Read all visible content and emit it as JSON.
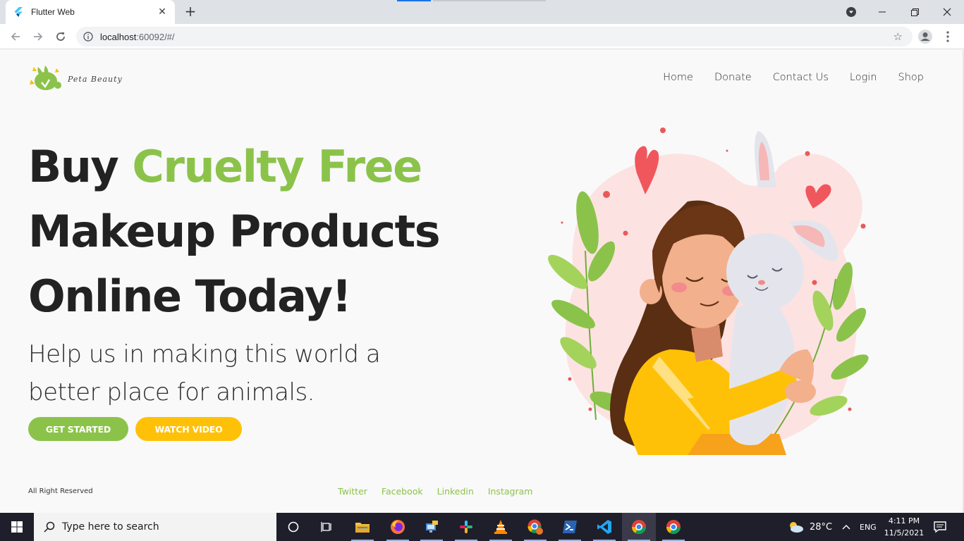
{
  "browser": {
    "tab_title": "Flutter Web",
    "url_host": "localhost",
    "url_rest": ":60092/#/",
    "close_glyph": "✕",
    "new_tab_glyph": "+"
  },
  "site": {
    "logo_text": "Peta Beauty",
    "nav": [
      "Home",
      "Donate",
      "Contact Us",
      "Login",
      "Shop"
    ],
    "headline_1a": "Buy ",
    "headline_1b": "Cruelty Free",
    "headline_2": "Makeup Products",
    "headline_3": "Online Today!",
    "subtitle": "Help us in making this world a better place for animals.",
    "cta_primary": "GET STARTED",
    "cta_secondary": "WATCH VIDEO",
    "footer_rights": "All Right Reserved",
    "social": [
      "Twitter",
      "Facebook",
      "Linkedin",
      "Instagram"
    ],
    "colors": {
      "green": "#8bc34a",
      "yellow": "#ffc107"
    }
  },
  "taskbar": {
    "search_placeholder": "Type here to search",
    "weather": "28°C",
    "lang": "ENG",
    "time": "4:11 PM",
    "date": "11/5/2021",
    "icons": [
      "cortana-icon",
      "task-view-icon",
      "file-explorer-icon",
      "firefox-icon",
      "remote-desktop-icon",
      "slack-icon",
      "vlc-icon",
      "chrome-profile-icon",
      "powershell-icon",
      "vscode-icon",
      "chrome-icon",
      "chrome-icon-2"
    ]
  }
}
